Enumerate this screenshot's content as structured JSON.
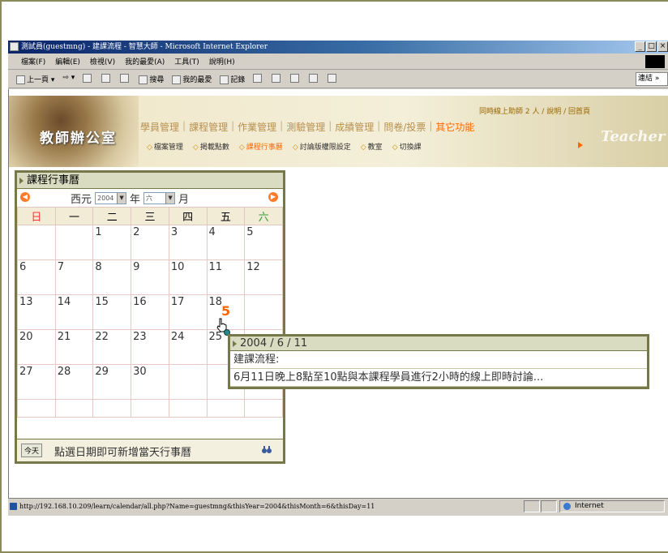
{
  "window": {
    "title": "測試員(guestmng) - 建課流程 - 智慧大師 - Microsoft Internet Explorer",
    "buttons": [
      "_",
      "□",
      "×"
    ]
  },
  "menubar": [
    "檔案(F)",
    "編輯(E)",
    "檢視(V)",
    "我的最愛(A)",
    "工具(T)",
    "說明(H)"
  ],
  "toolbar": {
    "back": "上一頁",
    "search": "搜尋",
    "favorites": "我的最愛",
    "history": "記錄",
    "address_label": "連結 »"
  },
  "header": {
    "logo": "教師辦公室",
    "online_info": "同時線上助師 2 人 / 說明 / 回首頁",
    "nav": [
      "學員管理",
      "課程管理",
      "作業管理",
      "測驗管理",
      "成績管理",
      "問卷/投票",
      "其它功能"
    ],
    "nav_active": "其它功能",
    "subnav": [
      "檔案管理",
      "掲載點數",
      "課程行事曆",
      "討論版權限設定",
      "教室",
      "切換課"
    ],
    "subnav_active": "課程行事曆",
    "teacher_logo": "Teacher"
  },
  "calendar": {
    "title": "課程行事曆",
    "era": "西元",
    "year": "2004",
    "year_unit": "年",
    "month": "六",
    "month_unit": "月",
    "weekdays": [
      "日",
      "一",
      "二",
      "三",
      "四",
      "五",
      "六"
    ],
    "weeks": [
      [
        "",
        "",
        "1",
        "2",
        "3",
        "4",
        "5"
      ],
      [
        "6",
        "7",
        "8",
        "9",
        "10",
        "11",
        "12"
      ],
      [
        "13",
        "14",
        "15",
        "16",
        "17",
        "18",
        ""
      ],
      [
        "20",
        "21",
        "22",
        "23",
        "24",
        "25",
        ""
      ],
      [
        "27",
        "28",
        "29",
        "30",
        "",
        "",
        ""
      ],
      [
        "",
        "",
        "",
        "",
        "",
        "",
        ""
      ]
    ],
    "today_button": "今天",
    "footer_text": "點選日期即可新增當天行事曆",
    "badge": "5"
  },
  "popup": {
    "date": "2004 / 6 / 11",
    "label": "建課流程:",
    "content": "6月11日晚上8點至10點與本課程學員進行2小時的線上即時討論..."
  },
  "statusbar": {
    "url": "http://192.168.10.209/learn/calendar/all.php?Name=guestmng&thisYear=2004&thisMonth=6&thisDay=11",
    "zone": "Internet"
  }
}
